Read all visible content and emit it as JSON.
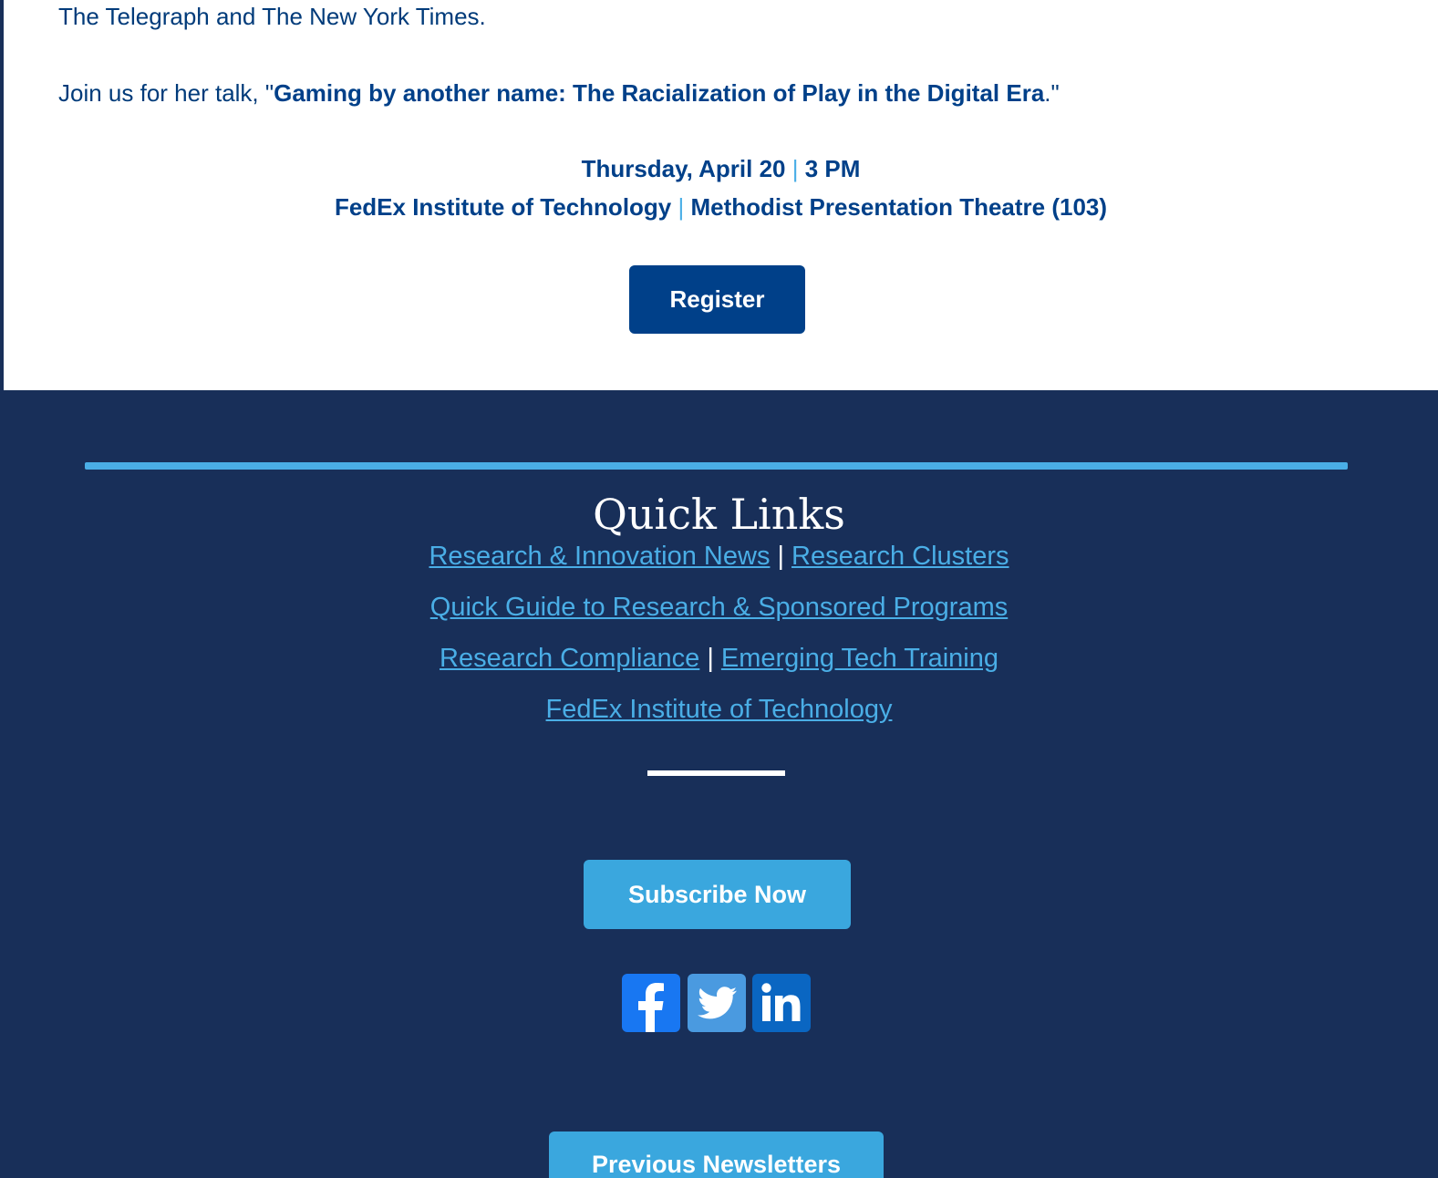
{
  "event": {
    "intro_text": "The Telegraph and The New York Times.",
    "talk_prefix": "Join us for her talk, \"",
    "talk_title": "Gaming by another name: The Racialization of Play in the Digital Era",
    "talk_suffix": ".\"",
    "date": "Thursday, April 20",
    "separator": "|",
    "time": "3 PM",
    "venue": "FedEx Institute of Technology",
    "room": "Methodist Presentation Theatre (103)",
    "register_label": "Register"
  },
  "footer": {
    "quick_links_title": "Quick Links",
    "separator": "|",
    "links": {
      "research_news": "Research & Innovation News",
      "research_clusters": "Research Clusters",
      "quick_guide": "Quick Guide to Research & Sponsored Programs",
      "research_compliance": "Research Compliance",
      "emerging_tech": "Emerging Tech Training",
      "fedex_institute": "FedEx Institute of Technology"
    },
    "subscribe_label": "Subscribe Now",
    "previous_label": "Previous Newsletters",
    "social": [
      {
        "name": "facebook-icon",
        "color": "#1877f2"
      },
      {
        "name": "twitter-icon",
        "color": "#4a9ae0"
      },
      {
        "name": "linkedin-icon",
        "color": "#0a66c2"
      }
    ]
  },
  "colors": {
    "navy": "#182f59",
    "brand_blue": "#004089",
    "accent_blue": "#4aaee6",
    "button_light": "#3aa7de"
  }
}
